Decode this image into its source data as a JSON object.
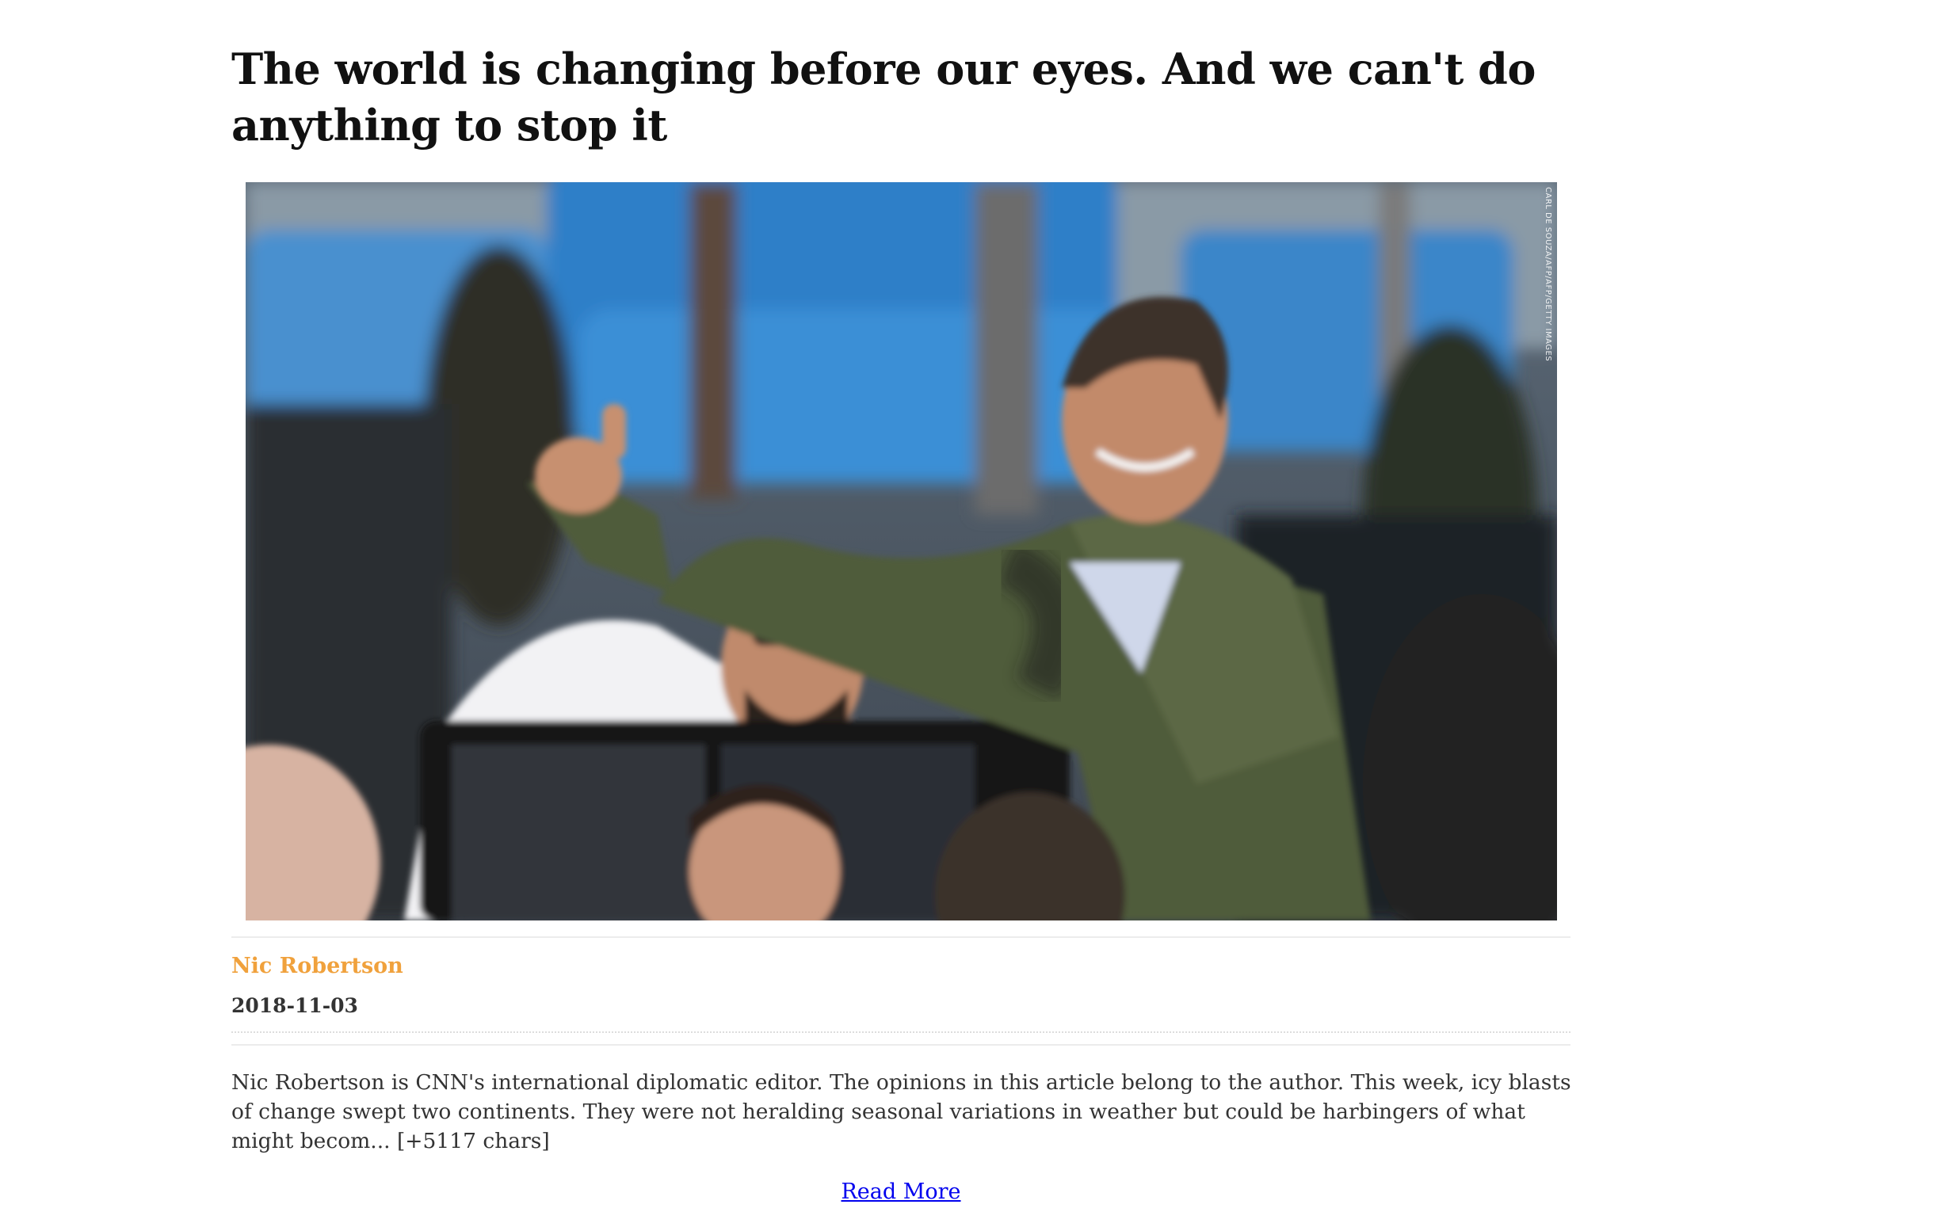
{
  "article": {
    "headline": "The world is changing before our eyes. And we can't do anything to stop it",
    "image": {
      "alt": "Jair Bolsonaro giving a thumbs up from a car",
      "credit": "CARL DE SOUZA/AFP/AFP/GETTY IMAGES"
    },
    "author": "Nic Robertson",
    "date": "2018-11-03",
    "summary": "Nic Robertson is CNN's international diplomatic editor. The opinions in this article belong to the author. This week, icy blasts of change swept two continents. They were not heralding seasonal variations in weather but could be harbingers of what might becom... [+5117 chars]",
    "read_more_label": "Read More"
  },
  "colors": {
    "author": "#f0a13c",
    "link": "#0000ee",
    "divider": "#ececec"
  }
}
